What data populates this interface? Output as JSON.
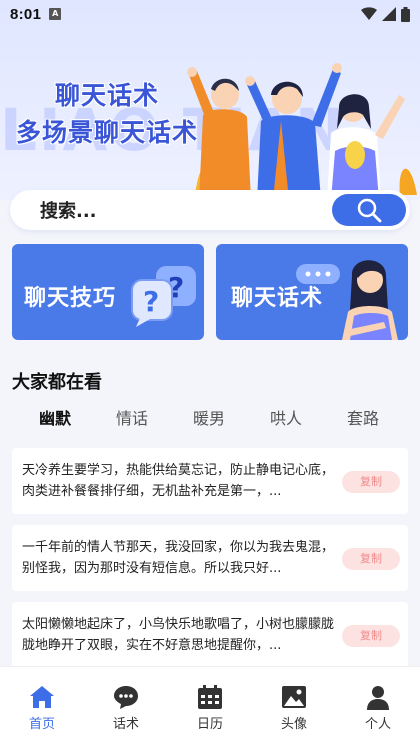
{
  "status_bar": {
    "time": "8:01",
    "sim_label": "A"
  },
  "hero": {
    "title_line1": "聊天话术",
    "title_line2": "多场景聊天话术",
    "bg_word": "LIAO TIAN"
  },
  "search": {
    "label": "搜索..."
  },
  "cards": [
    {
      "title": "聊天技巧"
    },
    {
      "title": "聊天话术"
    }
  ],
  "section": {
    "title": "大家都在看"
  },
  "tabs": [
    {
      "label": "幽默",
      "active": true
    },
    {
      "label": "情话",
      "active": false
    },
    {
      "label": "暖男",
      "active": false
    },
    {
      "label": "哄人",
      "active": false
    },
    {
      "label": "套路",
      "active": false
    }
  ],
  "items": [
    {
      "text": "天冷养生要学习，热能供给莫忘记，防止静电记心底，肉类进补餐餐排仔细，无机盐补充是第一，...",
      "copy_label": "复制"
    },
    {
      "text": "一千年前的情人节那天，我没回家，你以为我去鬼混，别怪我，因为那时没有短信息。所以我只好...",
      "copy_label": "复制"
    },
    {
      "text": "太阳懒懒地起床了，小鸟快乐地歌唱了，小树也朦朦胧胧地睁开了双眼，实在不好意思地提醒你，...",
      "copy_label": "复制"
    }
  ],
  "nav": [
    {
      "label": "首页",
      "icon": "home-icon",
      "active": true
    },
    {
      "label": "话术",
      "icon": "chat-icon",
      "active": false
    },
    {
      "label": "日历",
      "icon": "calendar-icon",
      "active": false
    },
    {
      "label": "头像",
      "icon": "image-icon",
      "active": false
    },
    {
      "label": "个人",
      "icon": "user-icon",
      "active": false
    }
  ],
  "colors": {
    "primary": "#3d6ee8",
    "card": "#4a79e8",
    "copy_bg": "#fde2e2",
    "copy_text": "#ef8a8a"
  }
}
